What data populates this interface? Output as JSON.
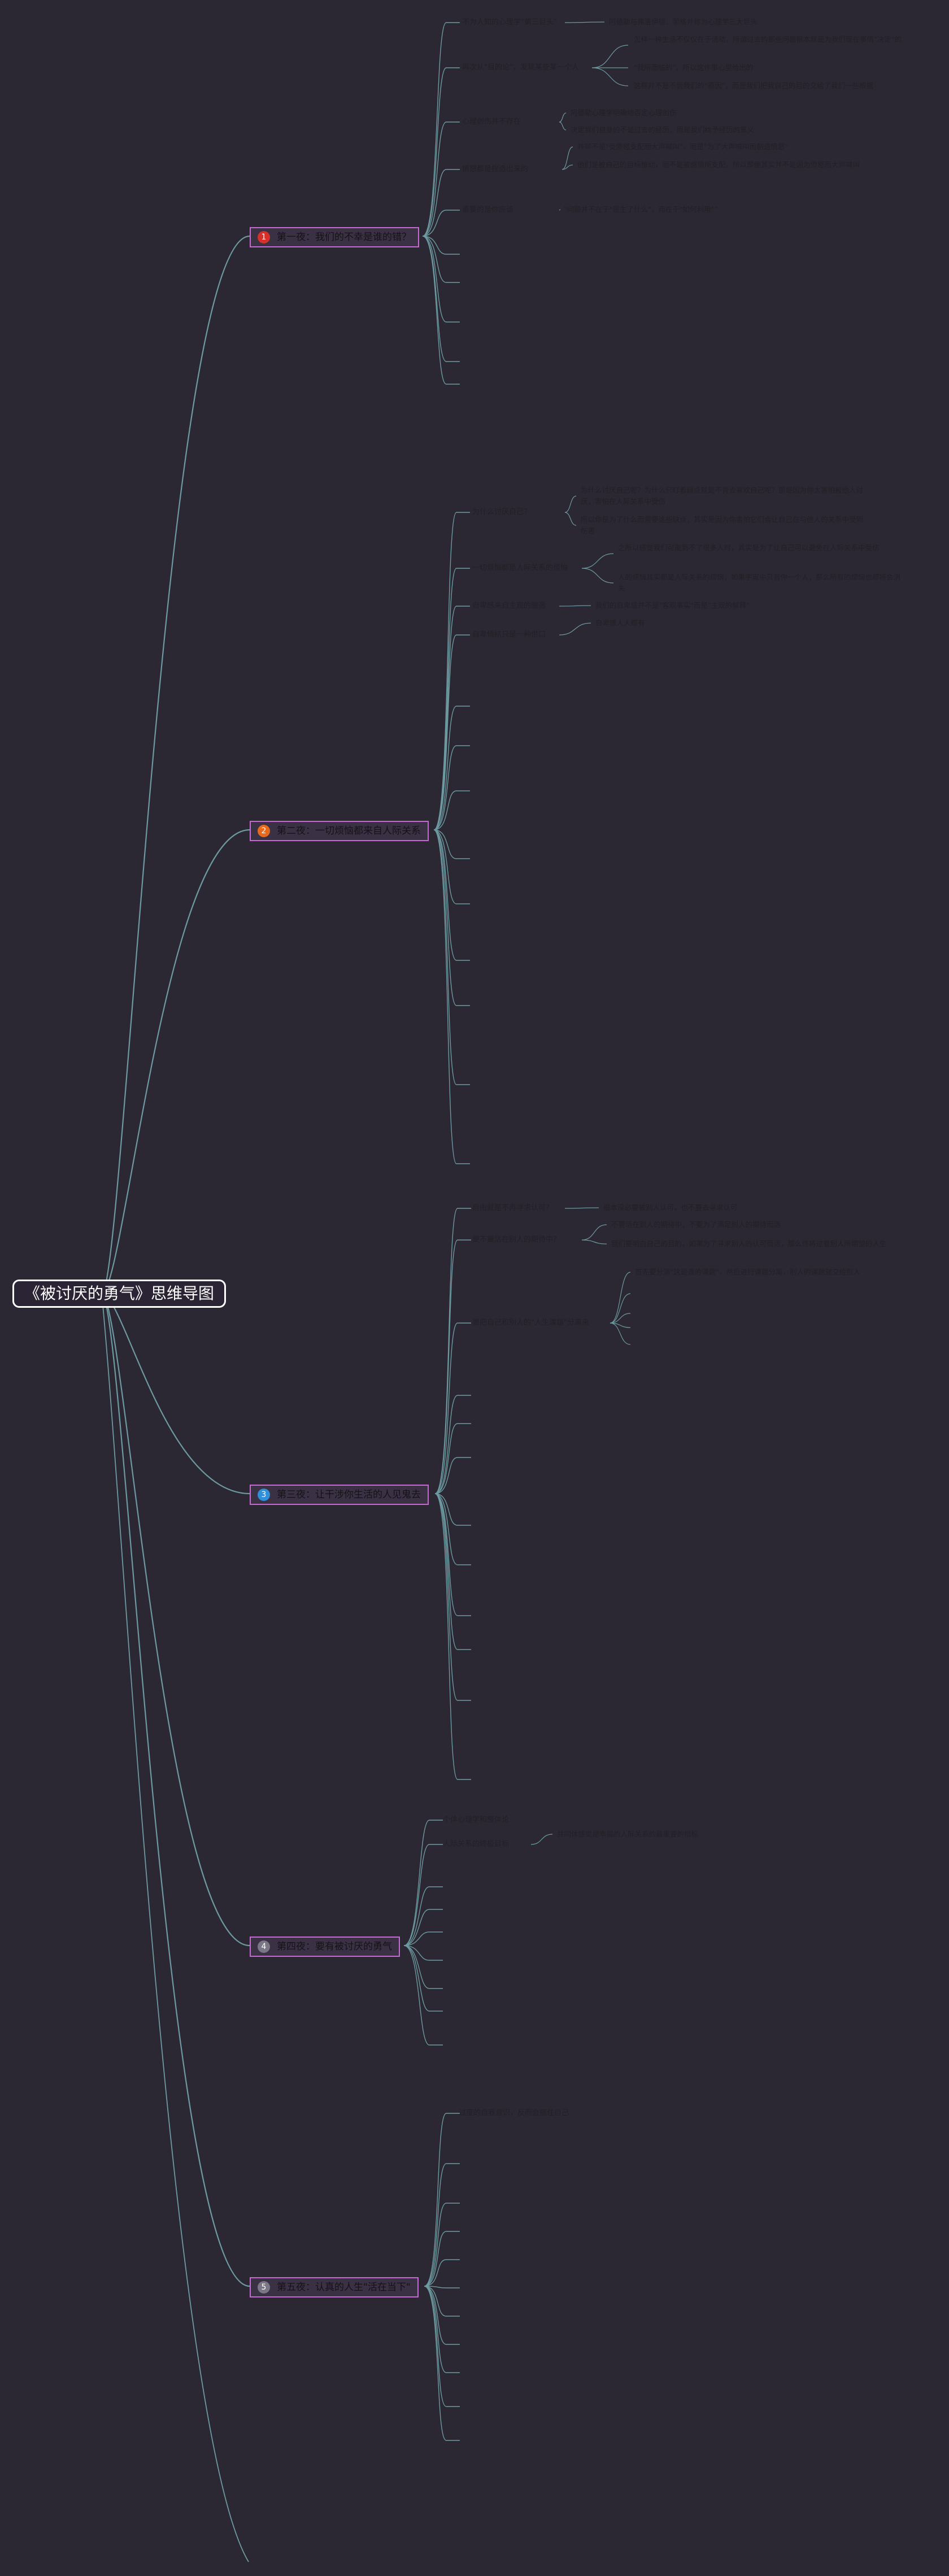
{
  "root": {
    "label": "《被讨厌的勇气》思维导图"
  },
  "colors": {
    "background": "#2b2833",
    "line": "#6c9aa0",
    "chapter_border": "#c56ad1",
    "badge_1": "#d6302a",
    "badge_2": "#e8681c",
    "badge_3": "#2f8fd8",
    "badge_4": "#7a7685",
    "badge_5": "#7a7685"
  },
  "chapters": [
    {
      "number": "1",
      "title": "第一夜：我们的不幸是谁的错？",
      "topics": [
        {
          "label": "不为人知的心理学\"第三巨头\"",
          "details": [
            "阿德勒与弗洛伊德、荣格并称为心理学三大巨头"
          ]
        },
        {
          "label": "再次从\"目的论\"，发现某些某一个人",
          "details": [
            "怎样一种生活不仅仅在于活动，所谓过去的那些问题根本就是为我们现在事情\"决定\"的",
            "\"我所面临的\"，所以这件事心里给出的",
            "这样并不是不管我们的\"原因\"，而是我们把我自己的目的交给了我们一些根据"
          ]
        },
        {
          "label": "心理创伤并不存在",
          "details": [
            "阿德勒心理学明确地否定心理创伤",
            "决定我们自身的不是过去的经历，而是我们给予经历的意义"
          ]
        },
        {
          "label": "愤怒都是捏造出来的",
          "details": [
            "并非不是\"受愤怒支配而大声喊叫\"，而是\"为了大声喊叫而制造愤怒\"",
            "他们是被自己的目标推动，而不是被感情所支配，所以即便其实并不是因为愤怒而大声喊叫"
          ]
        },
        {
          "label": "重要的是你应该",
          "details": [
            "\"问题并不在于\"是生了什么\"，而在于\"如何利用\"\""
          ]
        }
      ]
    },
    {
      "number": "2",
      "title": "第二夜：一切烦恼都来自人际关系",
      "topics": [
        {
          "label": "为什么讨厌自己？",
          "details": [
            "为什么讨厌自己呢？为什么只盯着缺点就是不肯去喜欢自己呢？那是因为你太害怕被他人讨厌，害怕在人际关系中受伤",
            "所以你是为了什么而需要这些缺点，其实是因为你害怕它们会让自己在与他人的关系中受到伤害"
          ]
        },
        {
          "label": "一切烦恼都是人际关系的烦恼",
          "details": [
            "之所以感觉我们可能到不了很多人时，其实是为了让自己可以避免在人际关系中受伤",
            "人的烦恼其实都是人际关系的烦恼，如果宇宙中只有你一个人，那么所有的烦恼也都将会消失"
          ]
        },
        {
          "label": "自卑感来自主观的臆造",
          "details": [
            "我们的自卑感并不是\"客观事实\"而是\"主观的解释\""
          ]
        },
        {
          "label": "自卑情结只是一种借口",
          "details": [
            "自卑感人人都有"
          ]
        }
      ]
    },
    {
      "number": "3",
      "title": "第三夜：让干涉你生活的人见鬼去",
      "topics": [
        {
          "label": "自由就是不再寻求认可？",
          "details": [
            "根本没必要被别人认可，也不要去寻求认可"
          ]
        },
        {
          "label": "要不要活在别人的期待中？",
          "details": [
            "不要活在别人的期待中，不要为了满足别人的期待而活",
            "我们要明白自己的目的，如果为了寻求别人的认可而活，那么终将过着别人所期望的人生"
          ]
        },
        {
          "label": "要把自己和别人的\"人生课题\"分离来",
          "details": [
            "首先要分清\"这是谁的课题\"，然后进行课题分离，别人的课题就交给别人"
          ]
        }
      ]
    },
    {
      "number": "4",
      "title": "第四夜：要有被讨厌的勇气",
      "topics": [
        {
          "label": "个体心理学和整体论",
          "details": []
        },
        {
          "label": "人际关系的终极目标",
          "details": [
            "共同体感觉是幸福的人际关系的最重要的指标"
          ]
        }
      ]
    },
    {
      "number": "5",
      "title": "第五夜：认真的人生\"活在当下\"",
      "topics": [
        {
          "label": "过度的自我意识，反而会捆住自己",
          "details": []
        }
      ]
    }
  ]
}
